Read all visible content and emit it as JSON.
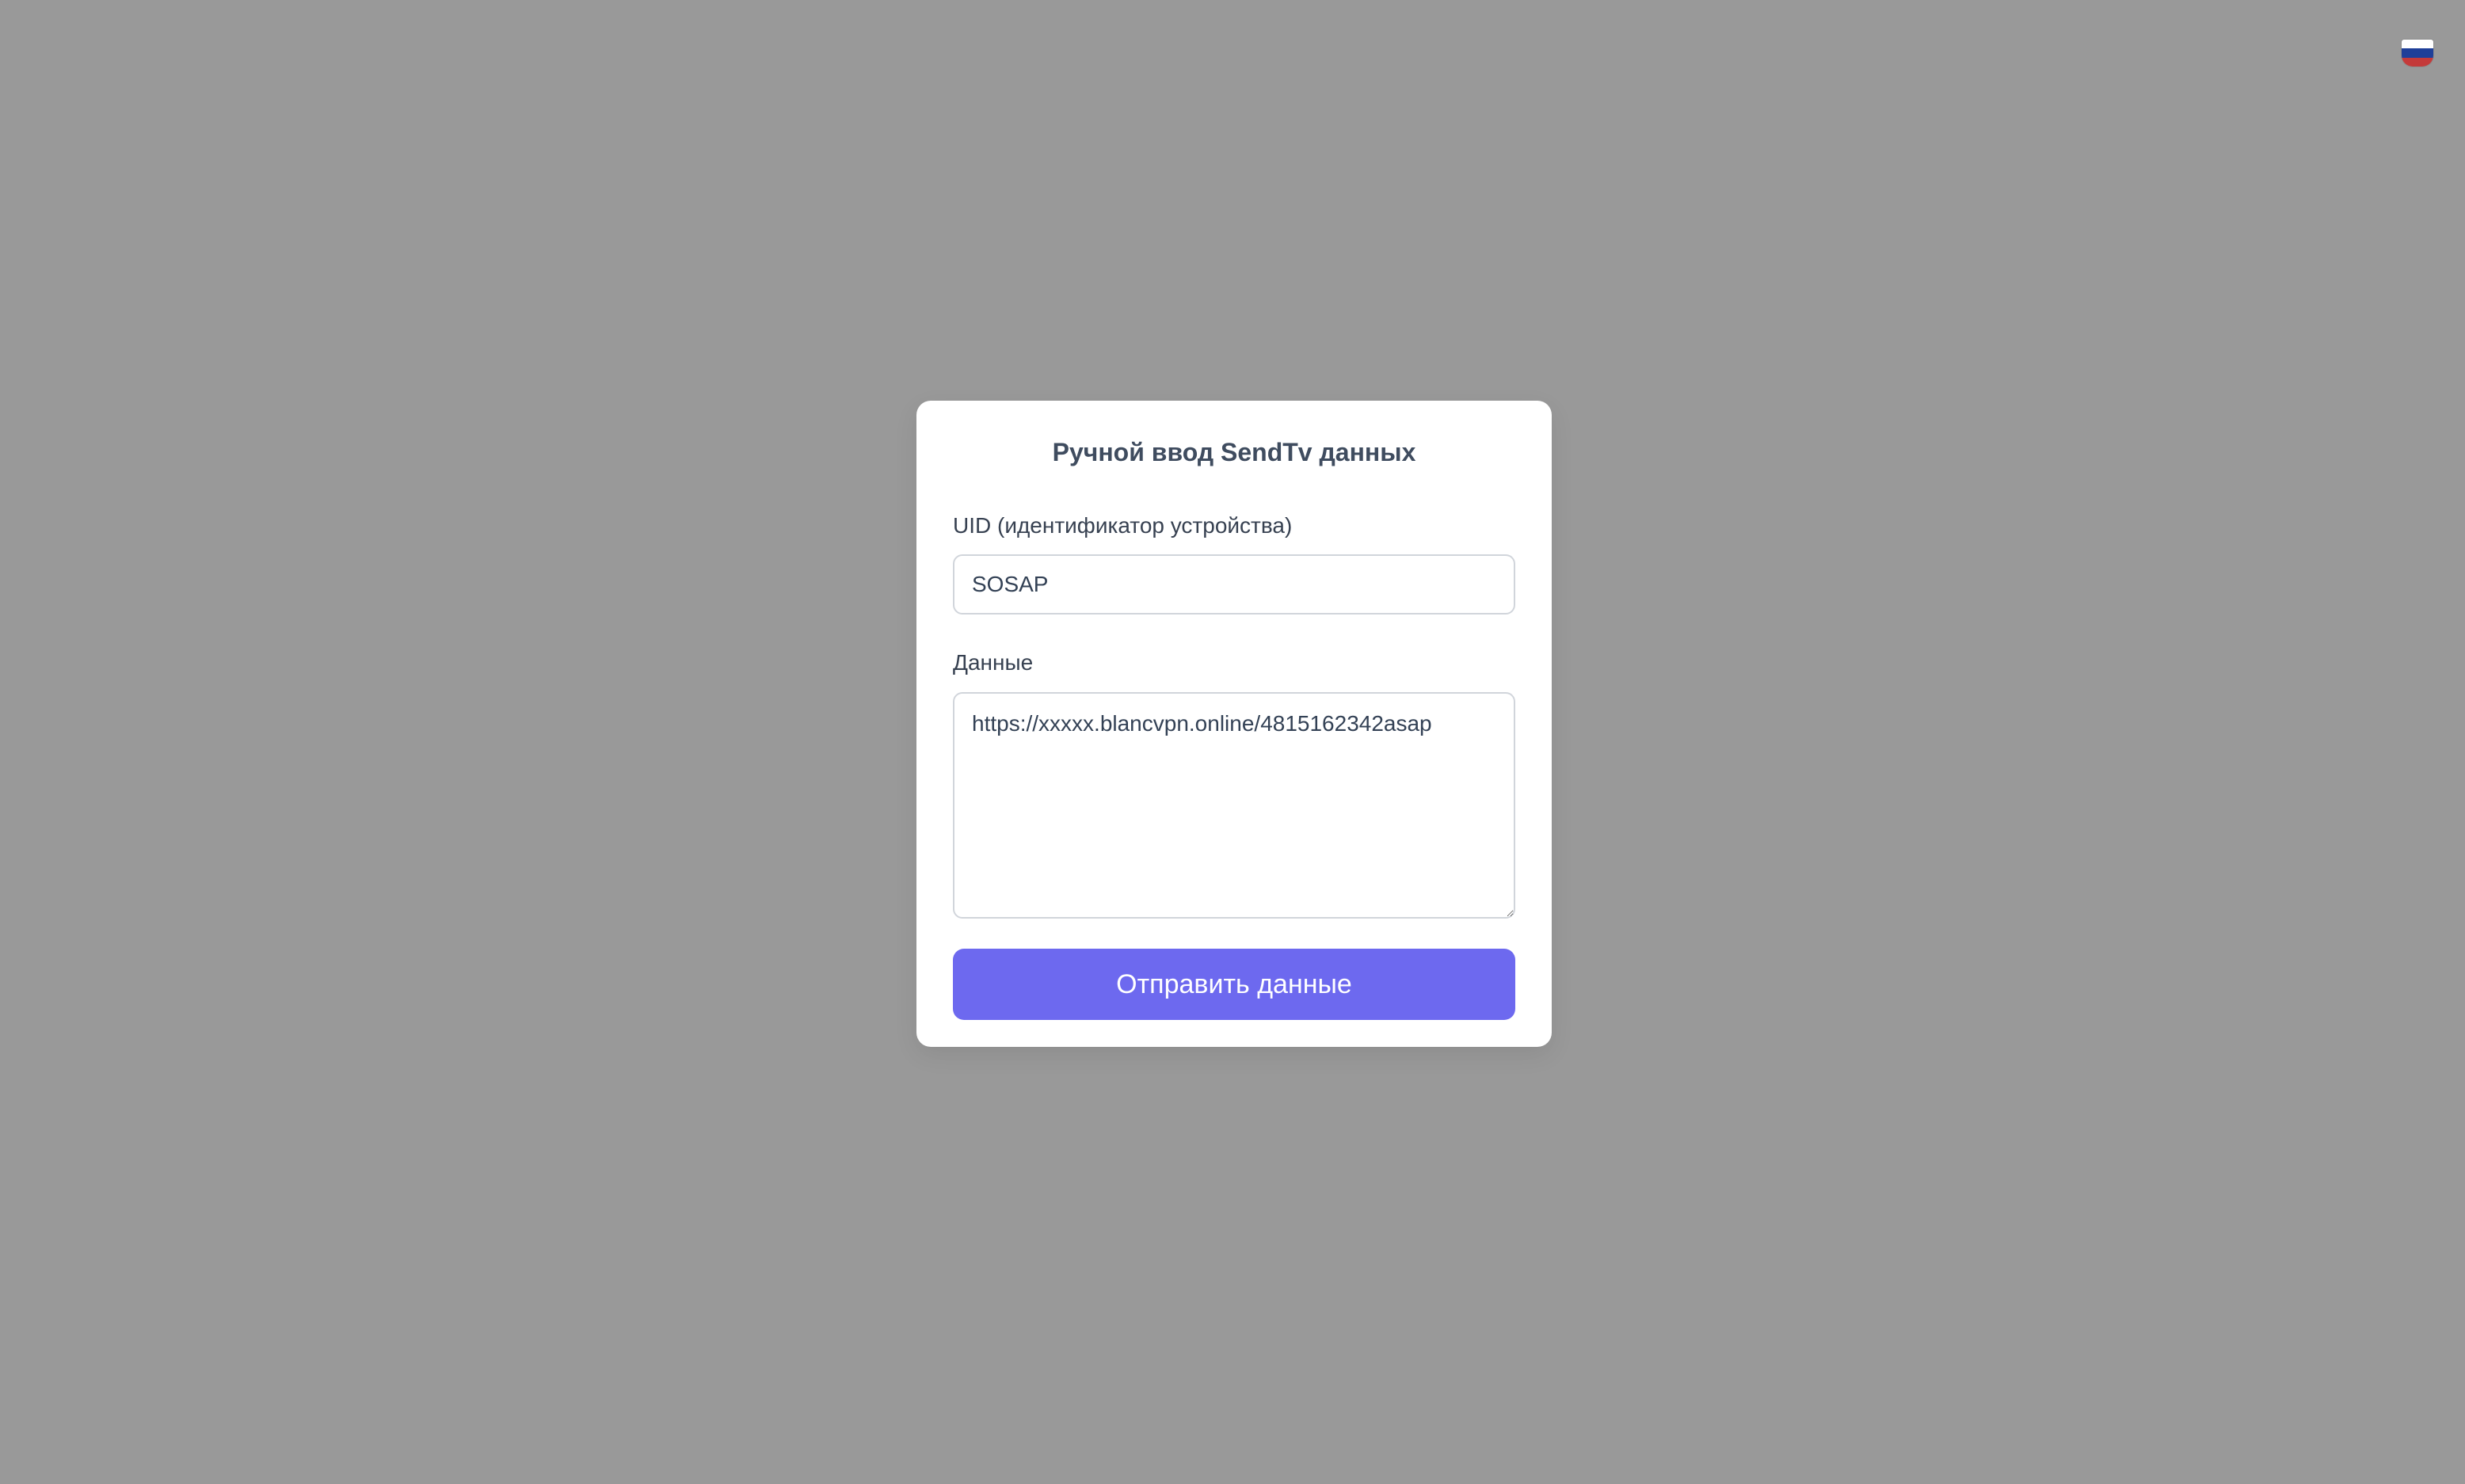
{
  "language_flag": {
    "icon": "russia-flag-icon",
    "colors": [
      "#ffffff",
      "#1f3f99",
      "#c43a3a"
    ]
  },
  "form": {
    "title": "Ручной ввод SendTv данных",
    "uid_label": "UID (идентификатор устройства)",
    "uid_value": "SOSAP",
    "data_label": "Данные",
    "data_value": "https://xxxxx.blancvpn.online/4815162342asap",
    "submit_label": "Отправить данные",
    "accent_color": "#6d69ef"
  }
}
